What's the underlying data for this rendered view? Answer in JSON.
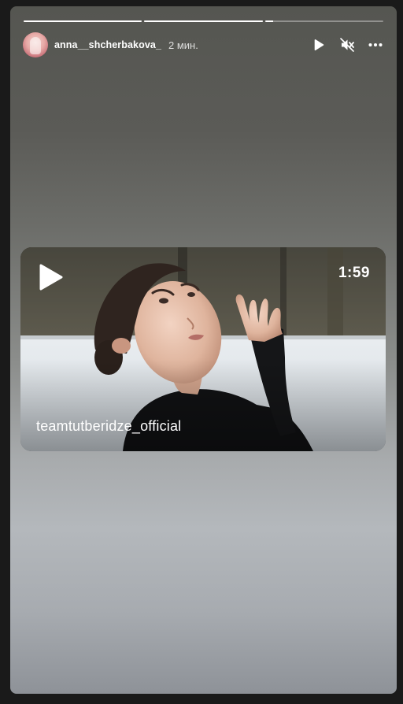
{
  "story": {
    "author": "anna__shcherbakova_",
    "time_ago": "2 мин.",
    "progress": [
      1.0,
      1.0,
      0.07
    ],
    "controls": {
      "play_icon": "play-icon",
      "mute_icon": "muted-speaker-icon",
      "more_icon": "more-horizontal-icon"
    }
  },
  "shared_post": {
    "duration": "1:59",
    "author": "teamtutberidze_official",
    "play_icon": "play-icon"
  },
  "colors": {
    "background": "#1a1a1a",
    "text": "#ffffff"
  }
}
